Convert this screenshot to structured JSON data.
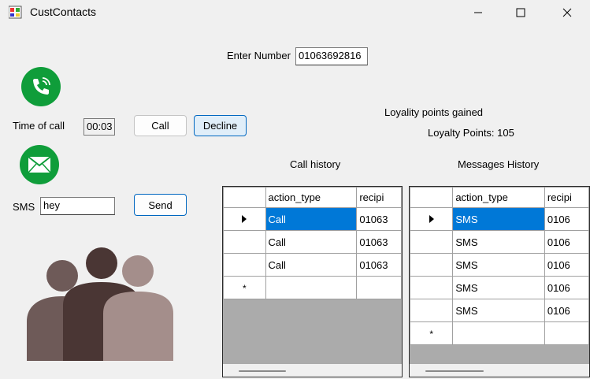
{
  "window": {
    "title": "CustContacts"
  },
  "form": {
    "enter_number_label": "Enter Number",
    "enter_number_value": "01063692816",
    "time_of_call_label": "Time of call",
    "time_of_call_value": "00:03",
    "call_button": "Call",
    "decline_button": "Decline",
    "sms_label": "SMS",
    "sms_value": "hey",
    "send_button": "Send",
    "loyalty_title": "Loyality points gained",
    "loyalty_points": "Loyalty Points: 105"
  },
  "call_history": {
    "title": "Call history",
    "columns": [
      "action_type",
      "recipi"
    ],
    "rows": [
      {
        "action_type": "Call",
        "recipient": "01063"
      },
      {
        "action_type": "Call",
        "recipient": "01063"
      },
      {
        "action_type": "Call",
        "recipient": "01063"
      }
    ]
  },
  "messages_history": {
    "title": "Messages History",
    "columns": [
      "action_type",
      "recipi"
    ],
    "rows": [
      {
        "action_type": "SMS",
        "recipient": "0106"
      },
      {
        "action_type": "SMS",
        "recipient": "0106"
      },
      {
        "action_type": "SMS",
        "recipient": "0106"
      },
      {
        "action_type": "SMS",
        "recipient": "0106"
      },
      {
        "action_type": "SMS",
        "recipient": "0106"
      }
    ]
  },
  "icons": {
    "app": "app-icon",
    "phone": "phone-icon",
    "mail": "mail-icon",
    "people": "people-icon"
  },
  "colors": {
    "accent": "#0078d7",
    "icon_green": "#0f9d3a"
  }
}
